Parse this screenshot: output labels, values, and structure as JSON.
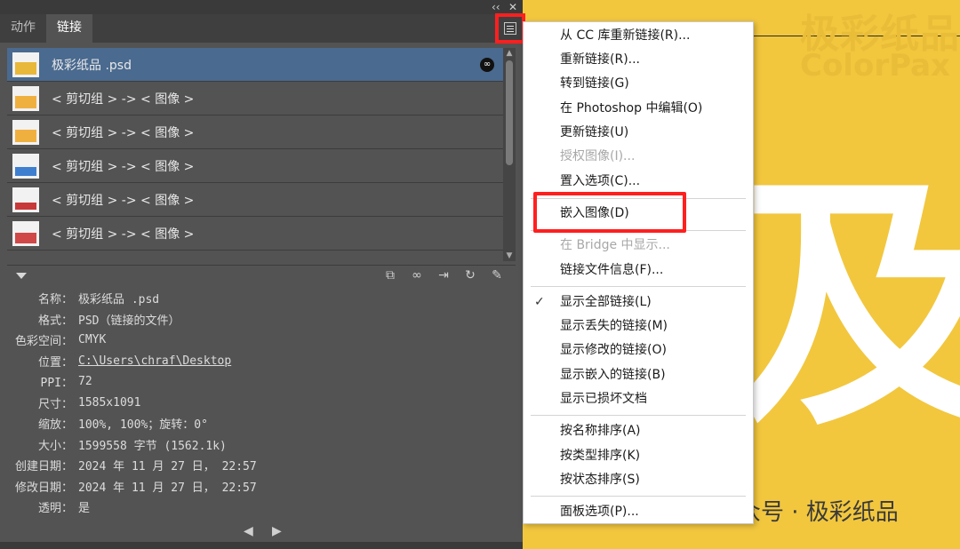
{
  "canvas": {
    "watermark_cn": "极彩纸品",
    "watermark_en": "ColorPax",
    "big_glyph": "及彩",
    "footer_watermark": "公众号 · 极彩纸品"
  },
  "panel": {
    "tabs": [
      {
        "label": "动作"
      },
      {
        "label": "链接"
      }
    ],
    "collapse_label": "‹‹",
    "close_label": "✕",
    "links": [
      {
        "label": "极彩纸品 .psd",
        "selected": true
      },
      {
        "label": "< 剪切组 > -> < 图像 >"
      },
      {
        "label": "< 剪切组 > -> < 图像 >"
      },
      {
        "label": "< 剪切组 > -> < 图像 >"
      },
      {
        "label": "< 剪切组 > -> < 图像 >"
      },
      {
        "label": "< 剪切组 > -> < 图像 >"
      }
    ],
    "info": [
      {
        "key": "名称：",
        "value": "极彩纸品 .psd"
      },
      {
        "key": "格式：",
        "value": "PSD（链接的文件）"
      },
      {
        "key": "色彩空间：",
        "value": "CMYK"
      },
      {
        "key": "位置：",
        "value": "C:\\Users\\chraf\\Desktop"
      },
      {
        "key": "PPI：",
        "value": "72"
      },
      {
        "key": "尺寸：",
        "value": "1585x1091"
      },
      {
        "key": "缩放：",
        "value": "100%, 100%；旋转：0°"
      },
      {
        "key": "大小：",
        "value": "1599558 字节 (1562.1k)"
      },
      {
        "key": "创建日期：",
        "value": "2024 年 11 月 27 日， 22:57"
      },
      {
        "key": "修改日期：",
        "value": "2024 年 11 月 27 日， 22:57"
      },
      {
        "key": "透明：",
        "value": "是"
      }
    ],
    "pager_prev": "◀",
    "pager_next": "▶"
  },
  "menu": {
    "items": [
      {
        "label": "从 CC 库重新链接(R)..."
      },
      {
        "label": "重新链接(R)..."
      },
      {
        "label": "转到链接(G)"
      },
      {
        "label": "在 Photoshop 中编辑(O)"
      },
      {
        "label": "更新链接(U)"
      },
      {
        "label": "授权图像(I)...",
        "disabled": true
      },
      {
        "label": "置入选项(C)..."
      },
      {
        "label": "嵌入图像(D)"
      },
      {
        "label": "在 Bridge 中显示...",
        "disabled": true
      },
      {
        "label": "链接文件信息(F)..."
      },
      {
        "label": "显示全部链接(L)",
        "checked": true
      },
      {
        "label": "显示丢失的链接(M)"
      },
      {
        "label": "显示修改的链接(O)"
      },
      {
        "label": "显示嵌入的链接(B)"
      },
      {
        "label": "显示已损坏文档"
      },
      {
        "label": "按名称排序(A)"
      },
      {
        "label": "按类型排序(K)"
      },
      {
        "label": "按状态排序(S)"
      },
      {
        "label": "面板选项(P)..."
      }
    ],
    "check_mark": "✓"
  },
  "colors": {
    "highlight_box": "#ff1f1f",
    "canvas_yellow": "#f2c73e",
    "selected_row": "#4a6a8f"
  }
}
